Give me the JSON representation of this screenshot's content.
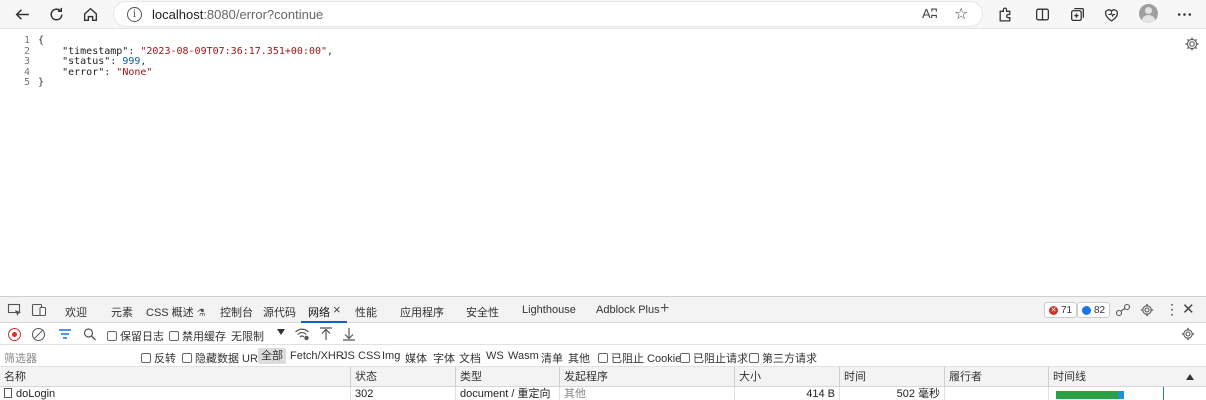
{
  "browser": {
    "url_host": "localhost",
    "url_rest": ":8080/error?continue",
    "reader_label": "Aʭ"
  },
  "json_viewer": {
    "lines": [
      {
        "n": "1",
        "text": "{"
      },
      {
        "n": "2",
        "key": "\"timestamp\"",
        "value": "\"2023-08-09T07:36:17.351+00:00\"",
        "kind": "str",
        "comma": ","
      },
      {
        "n": "3",
        "key": "\"status\"",
        "value": "999",
        "kind": "num",
        "comma": ","
      },
      {
        "n": "4",
        "key": "\"error\"",
        "value": "\"None\"",
        "kind": "str",
        "comma": ""
      },
      {
        "n": "5",
        "text": "}"
      }
    ]
  },
  "devtools": {
    "tabs": [
      "欢迎",
      "元素",
      "CSS 概述",
      "控制台",
      "源代码",
      "网络",
      "性能",
      "应用程序",
      "安全性",
      "Lighthouse",
      "Adblock Plus"
    ],
    "active_tab": "网络",
    "error_count": "71",
    "message_count": "82",
    "toolbar": {
      "preserve_log": "保留日志",
      "disable_cache": "禁用缓存",
      "throttle": "无限制"
    },
    "filter": {
      "placeholder": "筛选器",
      "invert": "反转",
      "hide_data_urls": "隐藏数据 URL",
      "types": [
        "全部",
        "Fetch/XHR",
        "JS",
        "CSS",
        "Img",
        "媒体",
        "字体",
        "文档",
        "WS",
        "Wasm",
        "清单",
        "其他"
      ],
      "blocked_cookies": "已阻止 Cookie",
      "blocked_requests": "已阻止请求",
      "third_party": "第三方请求"
    },
    "columns": [
      "名称",
      "状态",
      "类型",
      "发起程序",
      "大小",
      "时间",
      "履行者",
      "时间线"
    ],
    "rows": [
      {
        "name": "doLogin",
        "status": "302",
        "type": "document / 重定向",
        "initiator": "其他",
        "size": "414 B",
        "time": "502 毫秒",
        "fulfilled_by": ""
      }
    ]
  }
}
